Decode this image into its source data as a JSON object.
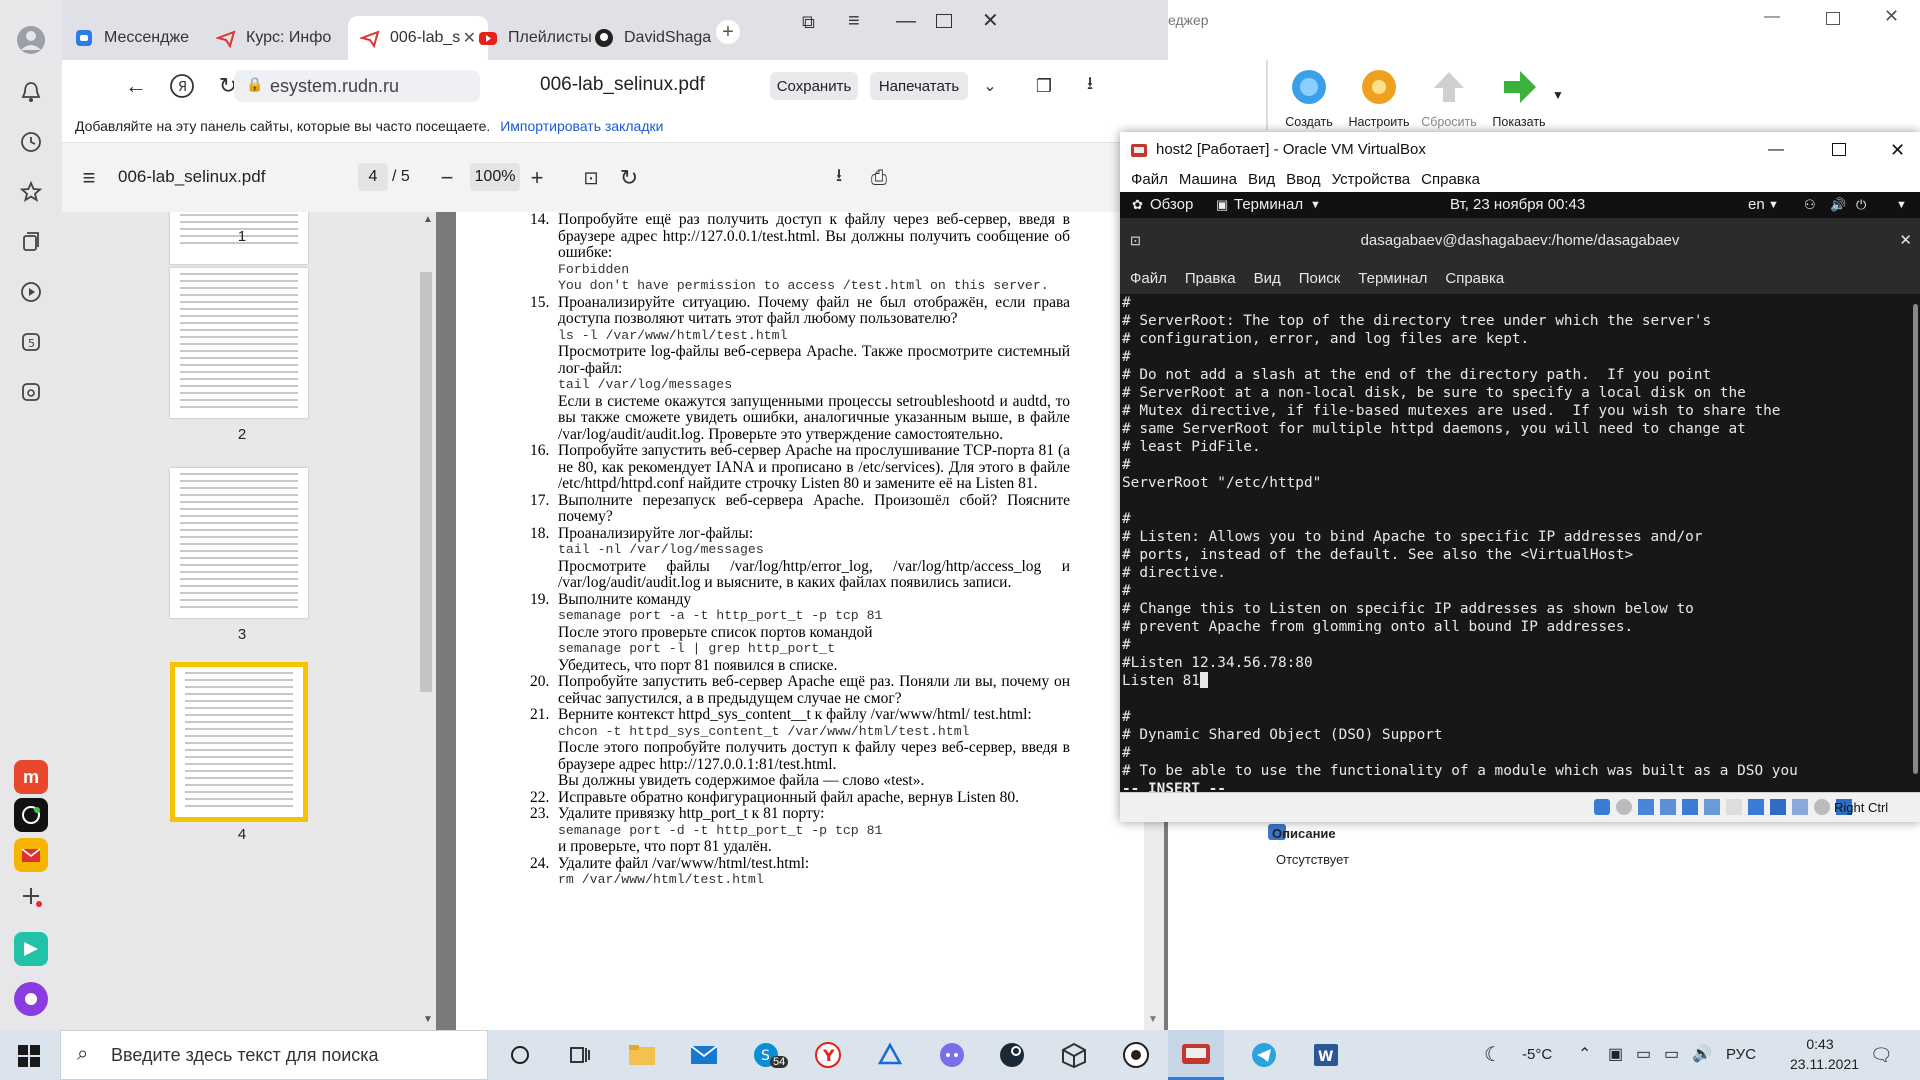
{
  "browser": {
    "tabs": [
      {
        "label": "Мессендже",
        "icon": "messenger-icon",
        "active": false
      },
      {
        "label": "Курс: Инфо",
        "icon": "course-icon",
        "active": false
      },
      {
        "label": "006-lab_s",
        "icon": "pdf-tab-icon",
        "active": true
      },
      {
        "label": "Плейлисты",
        "icon": "youtube-icon",
        "active": false
      },
      {
        "label": "DavidShaga",
        "icon": "github-icon",
        "active": false
      }
    ],
    "url": "esystem.rudn.ru",
    "doc_title": "006-lab_selinux.pdf",
    "save_label": "Сохранить",
    "print_label": "Напечатать",
    "bookmark_hint": "Добавляйте на эту панель сайты, которые вы часто посещаете.",
    "import_link": "Импортировать закладки"
  },
  "pdf": {
    "filename": "006-lab_selinux.pdf",
    "current_page": "4",
    "total_pages": "/ 5",
    "zoom": "100%",
    "thumbnails": [
      "1",
      "2",
      "3",
      "4"
    ],
    "items": [
      {
        "num": "14.",
        "text": "Попробуйте ещё раз получить доступ к файлу через веб-сервер, введя в браузере адрес http://127.0.0.1/test.html. Вы должны получить сообщение об ошибке:"
      },
      {
        "num": "",
        "code1": "Forbidden",
        "code2": "You don't have permission to access /test.html on this server."
      },
      {
        "num": "15.",
        "text": "Проанализируйте ситуацию. Почему файл не был отображён, если права доступа позволяют читать этот файл любому пользователю?"
      },
      {
        "num": "",
        "code1": "ls -l /var/www/html/test.html"
      },
      {
        "num": "",
        "text": "Просмотрите log-файлы веб-сервера Apache. Также просмотрите системный лог-файл:"
      },
      {
        "num": "",
        "code1": "tail /var/log/messages"
      },
      {
        "num": "",
        "text": "Если в системе окажутся запущенными процессы setroubleshootd и audtd, то вы также сможете увидеть ошибки, аналогичные указанным выше, в файле /var/log/audit/audit.log. Проверьте это утверждение самостоятельно."
      },
      {
        "num": "16.",
        "text": "Попробуйте запустить веб-сервер Apache на прослушивание TCP-порта 81 (а не 80, как рекомендует IANA и прописано в /etc/services). Для этого в файле /etc/httpd/httpd.conf найдите строчку Listen 80 и замените её на Listen 81."
      },
      {
        "num": "17.",
        "text": "Выполните перезапуск веб-сервера Apache. Произошёл сбой? Поясните почему?"
      },
      {
        "num": "18.",
        "text": "Проанализируйте лог-файлы:"
      },
      {
        "num": "",
        "code1": "tail -nl /var/log/messages"
      },
      {
        "num": "",
        "text": "Просмотрите файлы /var/log/http/error_log, /var/log/http/access_log и /var/log/audit/audit.log и выясните, в каких файлах появились записи."
      },
      {
        "num": "19.",
        "text": "Выполните команду"
      },
      {
        "num": "",
        "code1": "semanage port -a -t http_port_t -p tcp 81"
      },
      {
        "num": "",
        "text": "После этого проверьте список портов командой"
      },
      {
        "num": "",
        "code1": "semanage port -l | grep http_port_t"
      },
      {
        "num": "",
        "text": "Убедитесь, что порт 81 появился в списке."
      },
      {
        "num": "20.",
        "text": "Попробуйте запустить веб-сервер Apache ещё раз. Поняли ли вы, почему он сейчас запустился, а в предыдущем случае не смог?"
      },
      {
        "num": "21.",
        "text": "Верните контекст httpd_sys_content__t к файлу /var/www/html/ test.html:"
      },
      {
        "num": "",
        "code1": "chcon -t httpd_sys_content_t /var/www/html/test.html"
      },
      {
        "num": "",
        "text": "После этого попробуйте получить доступ к файлу через веб-сервер, введя в браузере адрес http://127.0.0.1:81/test.html."
      },
      {
        "num": "",
        "text": "Вы должны увидеть содержимое файла — слово «test»."
      },
      {
        "num": "22.",
        "text": "Исправьте обратно конфигурационный файл apache, вернув Listen 80."
      },
      {
        "num": "23.",
        "text": "Удалите привязку http_port_t к 81 порту:"
      },
      {
        "num": "",
        "code1": "semanage port -d -t http_port_t -p tcp 81"
      },
      {
        "num": "",
        "text": "и проверьте, что порт 81 удалён."
      },
      {
        "num": "24.",
        "text": "Удалите файл /var/www/html/test.html:"
      },
      {
        "num": "",
        "code1": "rm /var/www/html/test.html"
      }
    ]
  },
  "vbox_manager": {
    "title_fragment": "еджер",
    "tools": [
      {
        "label": "Создать",
        "icon": "create-gear-icon",
        "color": "#3aa0e8"
      },
      {
        "label": "Настроить",
        "icon": "settings-gear-icon",
        "color": "#f0a020"
      },
      {
        "label": "Сбросить",
        "icon": "discard-arrow-icon",
        "color": "#c8c8c8"
      },
      {
        "label": "Показать",
        "icon": "show-arrow-icon",
        "color": "#3bb23b"
      }
    ],
    "description_title": "Описание",
    "description_value": "Отсутствует"
  },
  "vm": {
    "title": "host2 [Работает] - Oracle VM VirtualBox",
    "menu": [
      "Файл",
      "Машина",
      "Вид",
      "Ввод",
      "Устройства",
      "Справка"
    ],
    "gnome": {
      "overview": "Обзор",
      "terminal_app": "Терминал",
      "datetime": "Вт, 23 ноября  00:43",
      "lang": "en"
    },
    "terminal_title": "dasagabaev@dashagabaev:/home/dasagabaev",
    "terminal_menu": [
      "Файл",
      "Правка",
      "Вид",
      "Поиск",
      "Терминал",
      "Справка"
    ],
    "terminal_lines": [
      "#",
      "# ServerRoot: The top of the directory tree under which the server's",
      "# configuration, error, and log files are kept.",
      "#",
      "# Do not add a slash at the end of the directory path.  If you point",
      "# ServerRoot at a non-local disk, be sure to specify a local disk on the",
      "# Mutex directive, if file-based mutexes are used.  If you wish to share the",
      "# same ServerRoot for multiple httpd daemons, you will need to change at",
      "# least PidFile.",
      "#",
      "ServerRoot \"/etc/httpd\"",
      "",
      "#",
      "# Listen: Allows you to bind Apache to specific IP addresses and/or",
      "# ports, instead of the default. See also the <VirtualHost>",
      "# directive.",
      "#",
      "# Change this to Listen on specific IP addresses as shown below to",
      "# prevent Apache from glomming onto all bound IP addresses.",
      "#",
      "#Listen 12.34.56.78:80",
      "Listen 81",
      "",
      "#",
      "# Dynamic Shared Object (DSO) Support",
      "#",
      "# To be able to use the functionality of a module which was built as a DSO you"
    ],
    "mode_line": "-- INSERT --",
    "host_key": "Right Ctrl"
  },
  "taskbar": {
    "search_placeholder": "Введите здесь текст для поиска",
    "weather": "-5°C",
    "lang": "РУС",
    "time": "0:43",
    "date": "23.11.2021",
    "skype_badge": "54"
  }
}
